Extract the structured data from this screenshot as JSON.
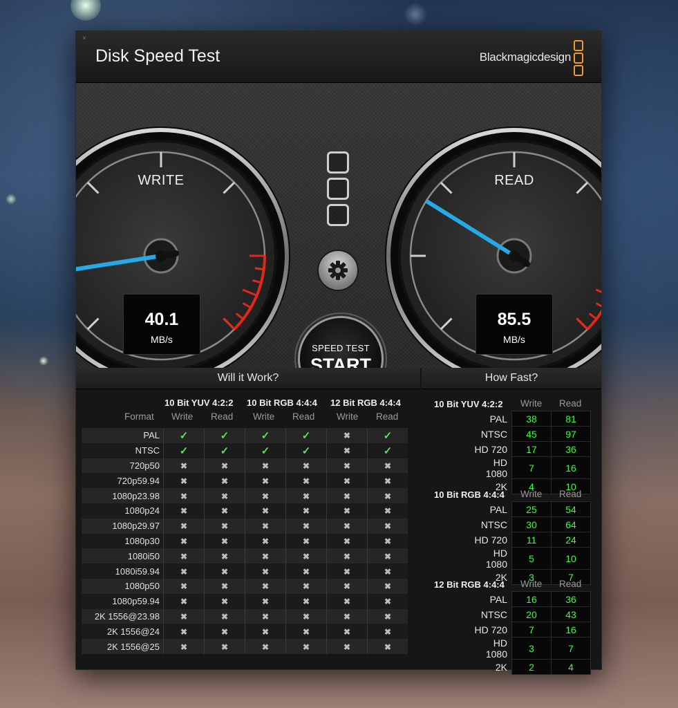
{
  "window": {
    "title": "Disk Speed Test",
    "brand": "Blackmagicdesign",
    "close_glyph": "×"
  },
  "gauges": {
    "write": {
      "label": "WRITE",
      "value": "40.1",
      "unit": "MB/s",
      "needle_value": 40.1
    },
    "read": {
      "label": "READ",
      "value": "85.5",
      "unit": "MB/s",
      "needle_value": 85.5
    }
  },
  "start_button": {
    "line1": "SPEED TEST",
    "line2": "START"
  },
  "icons": {
    "settings": "gear-icon",
    "logo": "blackmagic-logo-icon"
  },
  "colors": {
    "needle": "#27a9e8",
    "redline": "#e0281c",
    "pass": "#5fe05a",
    "fast_value": "#38ff3a",
    "brand_orange": "#f39a27"
  },
  "will_it_work": {
    "title": "Will it Work?",
    "format_header": "Format",
    "groups": [
      "10 Bit YUV 4:2:2",
      "10 Bit RGB 4:4:4",
      "12 Bit RGB 4:4:4"
    ],
    "write_label": "Write",
    "read_label": "Read",
    "rows": [
      {
        "format": "PAL",
        "results": [
          true,
          true,
          true,
          true,
          false,
          true
        ]
      },
      {
        "format": "NTSC",
        "results": [
          true,
          true,
          true,
          true,
          false,
          true
        ]
      },
      {
        "format": "720p50",
        "results": [
          false,
          false,
          false,
          false,
          false,
          false
        ]
      },
      {
        "format": "720p59.94",
        "results": [
          false,
          false,
          false,
          false,
          false,
          false
        ]
      },
      {
        "format": "1080p23.98",
        "results": [
          false,
          false,
          false,
          false,
          false,
          false
        ]
      },
      {
        "format": "1080p24",
        "results": [
          false,
          false,
          false,
          false,
          false,
          false
        ]
      },
      {
        "format": "1080p29.97",
        "results": [
          false,
          false,
          false,
          false,
          false,
          false
        ]
      },
      {
        "format": "1080p30",
        "results": [
          false,
          false,
          false,
          false,
          false,
          false
        ]
      },
      {
        "format": "1080i50",
        "results": [
          false,
          false,
          false,
          false,
          false,
          false
        ]
      },
      {
        "format": "1080i59.94",
        "results": [
          false,
          false,
          false,
          false,
          false,
          false
        ]
      },
      {
        "format": "1080p50",
        "results": [
          false,
          false,
          false,
          false,
          false,
          false
        ]
      },
      {
        "format": "1080p59.94",
        "results": [
          false,
          false,
          false,
          false,
          false,
          false
        ]
      },
      {
        "format": "2K 1556@23.98",
        "results": [
          false,
          false,
          false,
          false,
          false,
          false
        ]
      },
      {
        "format": "2K 1556@24",
        "results": [
          false,
          false,
          false,
          false,
          false,
          false
        ]
      },
      {
        "format": "2K 1556@25",
        "results": [
          false,
          false,
          false,
          false,
          false,
          false
        ]
      }
    ]
  },
  "how_fast": {
    "title": "How Fast?",
    "write_label": "Write",
    "read_label": "Read",
    "sections": [
      {
        "title": "10 Bit YUV 4:2:2",
        "rows": [
          {
            "format": "PAL",
            "write": "38",
            "read": "81"
          },
          {
            "format": "NTSC",
            "write": "45",
            "read": "97"
          },
          {
            "format": "HD 720",
            "write": "17",
            "read": "36"
          },
          {
            "format": "HD 1080",
            "write": "7",
            "read": "16"
          },
          {
            "format": "2K",
            "write": "4",
            "read": "10"
          }
        ]
      },
      {
        "title": "10 Bit RGB 4:4:4",
        "rows": [
          {
            "format": "PAL",
            "write": "25",
            "read": "54"
          },
          {
            "format": "NTSC",
            "write": "30",
            "read": "64"
          },
          {
            "format": "HD 720",
            "write": "11",
            "read": "24"
          },
          {
            "format": "HD 1080",
            "write": "5",
            "read": "10"
          },
          {
            "format": "2K",
            "write": "3",
            "read": "7"
          }
        ]
      },
      {
        "title": "12 Bit RGB 4:4:4",
        "rows": [
          {
            "format": "PAL",
            "write": "16",
            "read": "36"
          },
          {
            "format": "NTSC",
            "write": "20",
            "read": "43"
          },
          {
            "format": "HD 720",
            "write": "7",
            "read": "16"
          },
          {
            "format": "HD 1080",
            "write": "3",
            "read": "7"
          },
          {
            "format": "2K",
            "write": "2",
            "read": "4"
          }
        ]
      }
    ]
  }
}
